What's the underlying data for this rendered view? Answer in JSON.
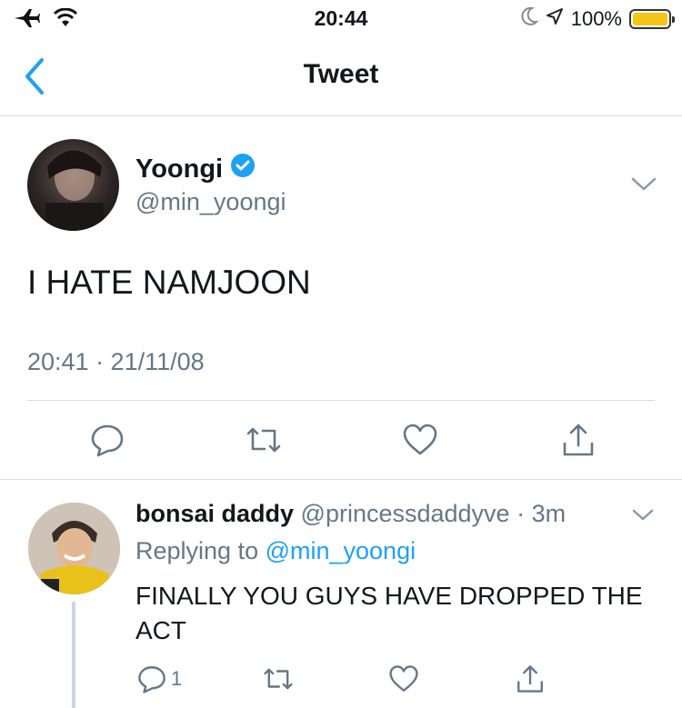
{
  "status_bar": {
    "time": "20:44",
    "battery": "100%",
    "battery_color": "#f5c518",
    "icons": [
      "airplane-icon",
      "wifi-icon",
      "moon-icon",
      "location-icon",
      "battery-icon"
    ]
  },
  "nav": {
    "title": "Tweet",
    "back_icon": "chevron-left-icon",
    "accent": "#1da1f2"
  },
  "tweet": {
    "author_name": "Yoongi",
    "verified": true,
    "handle": "@min_yoongi",
    "text": "I HATE NAMJOON",
    "meta": "20:41 · 21/11/08",
    "actions": [
      "reply-icon",
      "retweet-icon",
      "like-icon",
      "share-icon"
    ]
  },
  "reply": {
    "author_name": "bonsai daddy",
    "handle": "@princessdaddyve",
    "time": "· 3m",
    "replying_prefix": "Replying to ",
    "replying_to": "@min_yoongi",
    "text": "FINALLY YOU GUYS HAVE DROPPED THE ACT",
    "reply_count": "1",
    "actions": [
      "reply-icon",
      "retweet-icon",
      "like-icon",
      "share-icon"
    ]
  }
}
